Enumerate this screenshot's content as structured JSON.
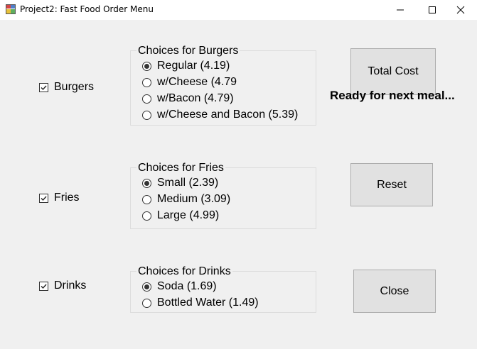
{
  "window": {
    "title": "Project2: Fast Food Order Menu",
    "controls": [
      "minimize-icon",
      "maximize-icon",
      "close-icon"
    ]
  },
  "categories": {
    "burgers": {
      "label": "Burgers",
      "checked": true
    },
    "fries": {
      "label": "Fries",
      "checked": true
    },
    "drinks": {
      "label": "Drinks",
      "checked": true
    }
  },
  "groups": {
    "burgers": {
      "title": "Choices for Burgers",
      "options": [
        {
          "label": "Regular (4.19)",
          "selected": true
        },
        {
          "label": "w/Cheese (4.79",
          "selected": false
        },
        {
          "label": "w/Bacon (4.79)",
          "selected": false
        },
        {
          "label": "w/Cheese and Bacon (5.39)",
          "selected": false
        }
      ]
    },
    "fries": {
      "title": "Choices for Fries",
      "options": [
        {
          "label": "Small (2.39)",
          "selected": true
        },
        {
          "label": "Medium (3.09)",
          "selected": false
        },
        {
          "label": "Large (4.99)",
          "selected": false
        }
      ]
    },
    "drinks": {
      "title": "Choices for Drinks",
      "options": [
        {
          "label": "Soda (1.69)",
          "selected": true
        },
        {
          "label": "Bottled Water (1.49)",
          "selected": false
        }
      ]
    }
  },
  "buttons": {
    "total_cost": "Total Cost",
    "reset": "Reset",
    "close": "Close"
  },
  "status": "Ready for next meal..."
}
